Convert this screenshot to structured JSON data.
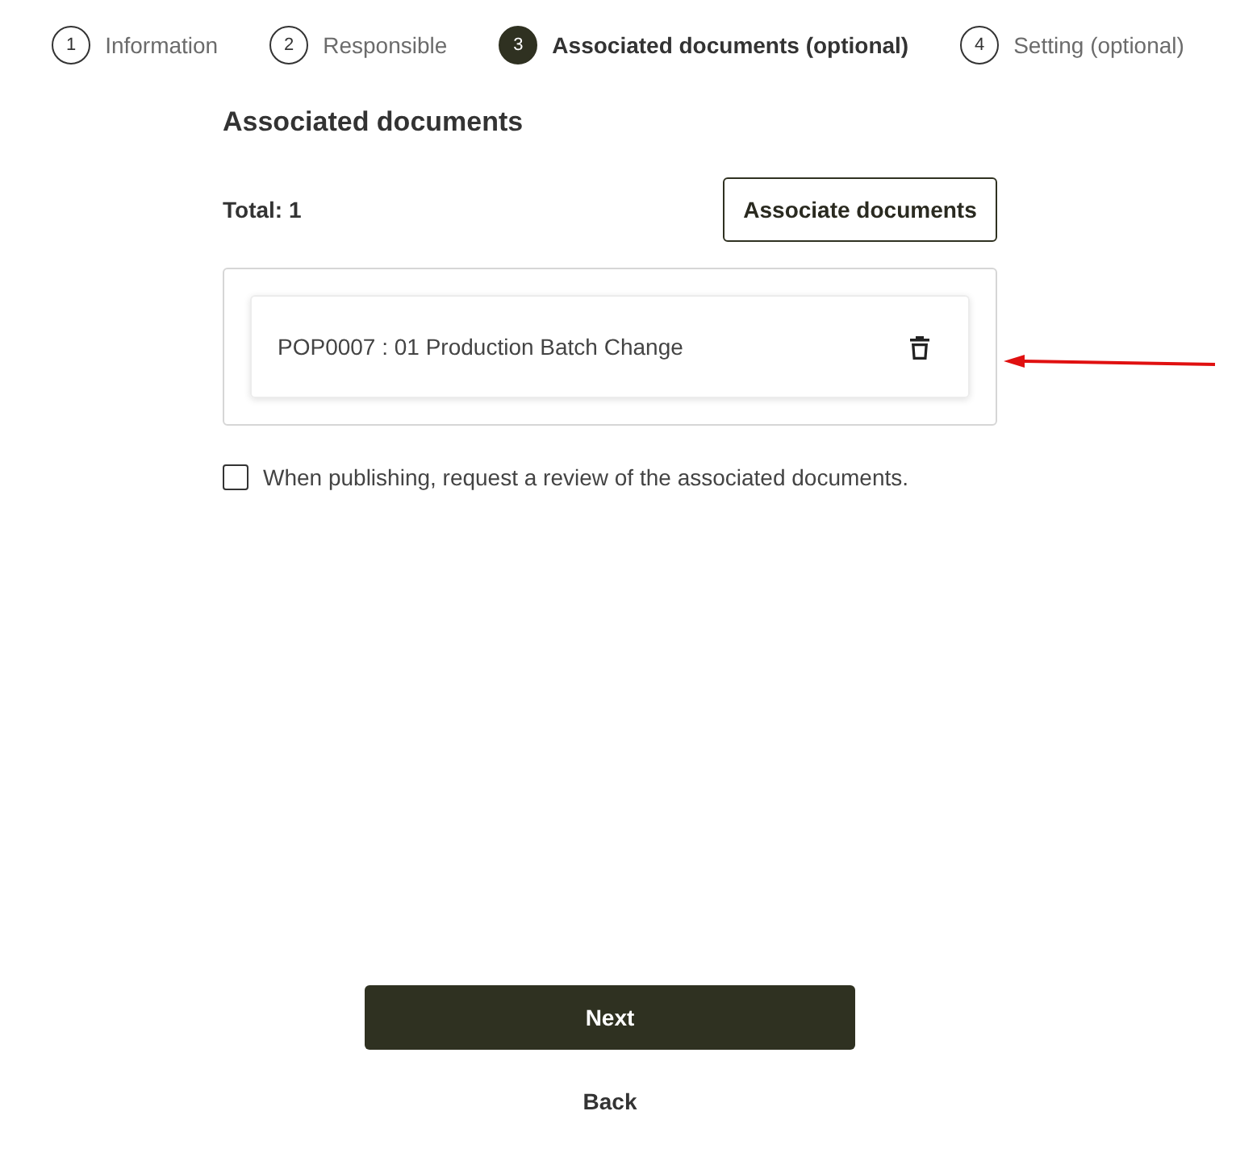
{
  "steps": [
    {
      "number": "1",
      "label": "Information",
      "selected": false
    },
    {
      "number": "2",
      "label": "Responsible",
      "selected": false
    },
    {
      "number": "3",
      "label": "Associated documents (optional)",
      "selected": true
    },
    {
      "number": "4",
      "label": "Setting (optional)",
      "selected": false
    }
  ],
  "section_title": "Associated documents",
  "total": "Total: 1",
  "associate_button": "Associate documents",
  "documents": [
    {
      "title": "POP0007 : 01 Production Batch Change"
    }
  ],
  "review_checkbox": {
    "label": "When publishing, request a review of the associated documents.",
    "checked": false
  },
  "next_button": "Next",
  "back_button": "Back"
}
